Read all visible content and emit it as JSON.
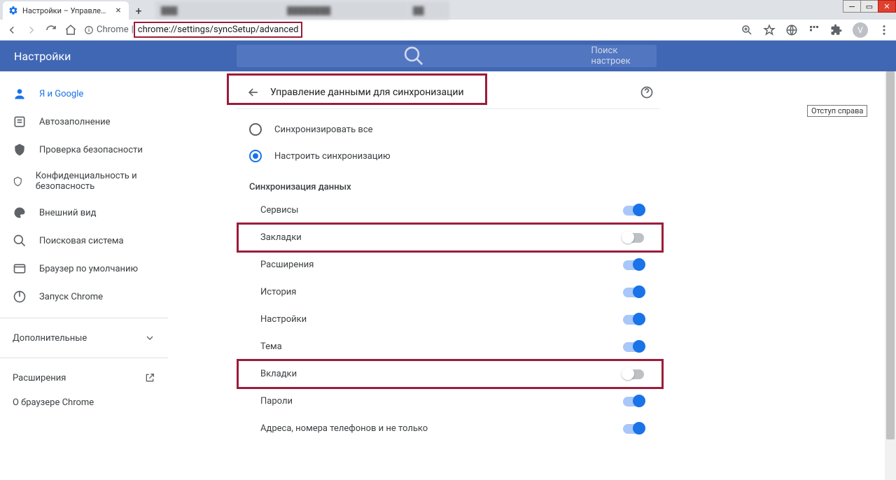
{
  "browser": {
    "active_tab": "Настройки – Управление данн",
    "url_prefix": "Chrome",
    "url": "chrome://settings/syncSetup/advanced",
    "avatar_letter": "V"
  },
  "header": {
    "title": "Настройки",
    "search_placeholder": "Поиск настроек"
  },
  "sidebar": {
    "items": [
      {
        "label": "Я и Google"
      },
      {
        "label": "Автозаполнение"
      },
      {
        "label": "Проверка безопасности"
      },
      {
        "label": "Конфиденциальность и безопасность"
      },
      {
        "label": "Внешний вид"
      },
      {
        "label": "Поисковая система"
      },
      {
        "label": "Браузер по умолчанию"
      },
      {
        "label": "Запуск Chrome"
      }
    ],
    "advanced": "Дополнительные",
    "extensions": "Расширения",
    "about": "О браузере Chrome"
  },
  "main": {
    "page_title": "Управление данными для синхронизации",
    "radio": {
      "sync_all": "Синхронизировать все",
      "customize": "Настроить синхронизацию"
    },
    "data_title": "Синхронизация данных",
    "toggles": [
      {
        "label": "Сервисы",
        "on": true,
        "hl": false
      },
      {
        "label": "Закладки",
        "on": false,
        "hl": true
      },
      {
        "label": "Расширения",
        "on": true,
        "hl": false
      },
      {
        "label": "История",
        "on": true,
        "hl": false
      },
      {
        "label": "Настройки",
        "on": true,
        "hl": false
      },
      {
        "label": "Тема",
        "on": true,
        "hl": false
      },
      {
        "label": "Вкладки",
        "on": false,
        "hl": true
      },
      {
        "label": "Пароли",
        "on": true,
        "hl": false
      },
      {
        "label": "Адреса, номера телефонов и не только",
        "on": true,
        "hl": false
      }
    ]
  },
  "tooltip": "Отступ справа"
}
